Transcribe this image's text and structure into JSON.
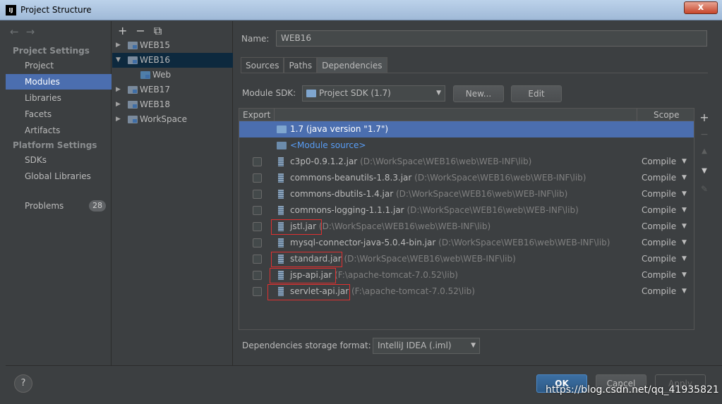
{
  "window": {
    "title": "Project Structure",
    "app_icon": "IJ",
    "close": "x"
  },
  "nav": {
    "project_settings_header": "Project Settings",
    "project_settings": [
      {
        "label": "Project",
        "selected": false
      },
      {
        "label": "Modules",
        "selected": true
      },
      {
        "label": "Libraries",
        "selected": false
      },
      {
        "label": "Facets",
        "selected": false
      },
      {
        "label": "Artifacts",
        "selected": false
      }
    ],
    "platform_settings_header": "Platform Settings",
    "platform_settings": [
      {
        "label": "SDKs"
      },
      {
        "label": "Global Libraries"
      }
    ],
    "problems_label": "Problems",
    "problems_count": "28"
  },
  "tree": {
    "items": [
      {
        "label": "WEB15",
        "expanded": false
      },
      {
        "label": "WEB16",
        "expanded": true,
        "selected": true
      },
      {
        "label": "Web",
        "child": true
      },
      {
        "label": "WEB17",
        "expanded": false
      },
      {
        "label": "WEB18",
        "expanded": false
      },
      {
        "label": "WorkSpace",
        "expanded": false
      }
    ]
  },
  "module": {
    "name_label": "Name:",
    "name_value": "WEB16",
    "tabs": [
      "Sources",
      "Paths",
      "Dependencies"
    ],
    "active_tab": "Dependencies",
    "sdk_label": "Module SDK:",
    "sdk_value": "Project SDK (1.7)",
    "new_button": "New...",
    "edit_button": "Edit",
    "table_header_export": "Export",
    "table_header_scope": "Scope",
    "dependencies": [
      {
        "name": "1.7 (java version \"1.7\")",
        "path": "",
        "kind": "sdk",
        "scope": ""
      },
      {
        "name": "<Module source>",
        "path": "",
        "kind": "source",
        "scope": ""
      },
      {
        "name": "c3p0-0.9.1.2.jar",
        "path": "(D:\\WorkSpace\\WEB16\\web\\WEB-INF\\lib)",
        "kind": "jar",
        "scope": "Compile"
      },
      {
        "name": "commons-beanutils-1.8.3.jar",
        "path": "(D:\\WorkSpace\\WEB16\\web\\WEB-INF\\lib)",
        "kind": "jar",
        "scope": "Compile"
      },
      {
        "name": "commons-dbutils-1.4.jar",
        "path": "(D:\\WorkSpace\\WEB16\\web\\WEB-INF\\lib)",
        "kind": "jar",
        "scope": "Compile"
      },
      {
        "name": "commons-logging-1.1.1.jar",
        "path": "(D:\\WorkSpace\\WEB16\\web\\WEB-INF\\lib)",
        "kind": "jar",
        "scope": "Compile"
      },
      {
        "name": "jstl.jar",
        "path": "(D:\\WorkSpace\\WEB16\\web\\WEB-INF\\lib)",
        "kind": "jar",
        "scope": "Compile",
        "highlighted": true
      },
      {
        "name": "mysql-connector-java-5.0.4-bin.jar",
        "path": "(D:\\WorkSpace\\WEB16\\web\\WEB-INF\\lib)",
        "kind": "jar",
        "scope": "Compile"
      },
      {
        "name": "standard.jar",
        "path": "(D:\\WorkSpace\\WEB16\\web\\WEB-INF\\lib)",
        "kind": "jar",
        "scope": "Compile",
        "highlighted": true
      },
      {
        "name": "jsp-api.jar",
        "path": "(F:\\apache-tomcat-7.0.52\\lib)",
        "kind": "jar",
        "scope": "Compile",
        "highlighted": true
      },
      {
        "name": "servlet-api.jar",
        "path": "(F:\\apache-tomcat-7.0.52\\lib)",
        "kind": "jar",
        "scope": "Compile",
        "highlighted": true
      }
    ],
    "storage_label": "Dependencies storage format:",
    "storage_value": "IntelliJ IDEA (.iml)"
  },
  "footer": {
    "help": "?",
    "ok": "OK",
    "cancel": "Cancel",
    "apply": "Apply",
    "watermark": "https://blog.csdn.net/qq_41935821"
  },
  "colors": {
    "accent": "#4b6eaf",
    "highlight_box": "#e03030",
    "link": "#589df6"
  }
}
